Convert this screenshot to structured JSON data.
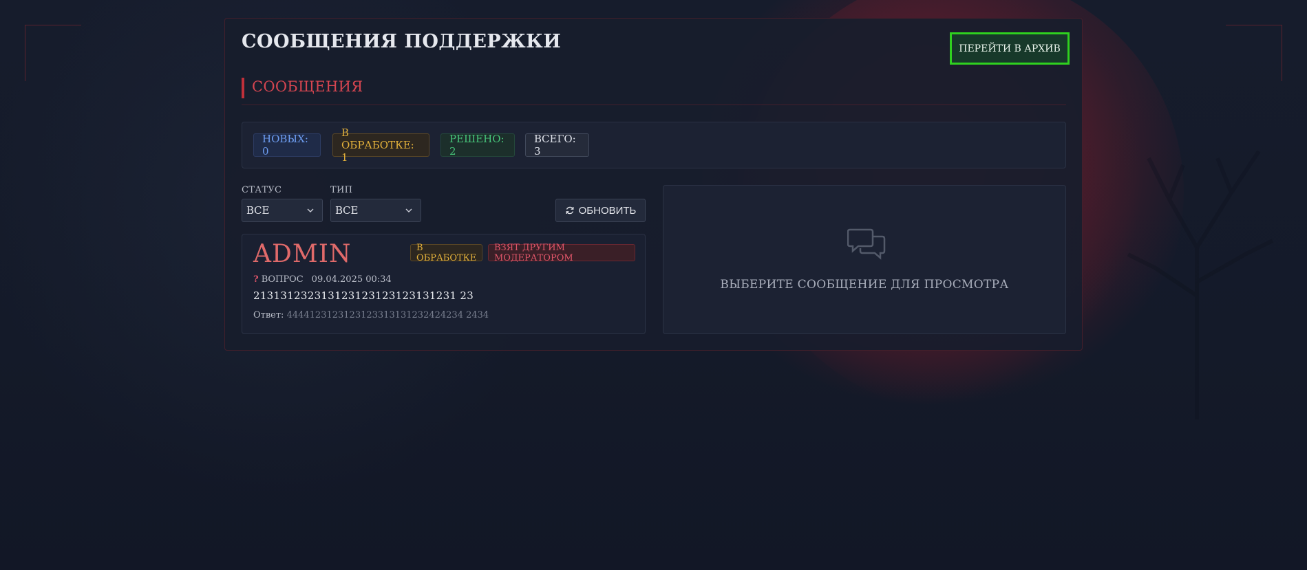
{
  "header": {
    "title": "СООБЩЕНИЯ ПОДДЕРЖКИ",
    "archive_button": "ПЕРЕЙТИ В АРХИВ"
  },
  "section": {
    "title": "СООБЩЕНИЯ"
  },
  "stats": {
    "new": "НОВЫХ: 0",
    "in_progress": "В ОБРАБОТКЕ: 1",
    "resolved": "РЕШЕНО: 2",
    "total": "ВСЕГО: 3"
  },
  "filters": {
    "status_label": "СТАТУС",
    "status_value": "ВСЕ",
    "type_label": "ТИП",
    "type_value": "ВСЕ",
    "refresh_button": "ОБНОВИТЬ"
  },
  "messages": [
    {
      "author": "ADMIN",
      "status_badge": "В ОБРАБОТКЕ",
      "assignee_badge": "ВЗЯТ ДРУГИМ МОДЕРАТОРОМ",
      "type": "ВОПРОС",
      "datetime": "09.04.2025 00:34",
      "text": "213131232313123123123123131231 23",
      "answer_label": "Ответ:",
      "answer_value": "4444123123123123313131232424234 2434"
    }
  ],
  "viewer": {
    "empty_text": "ВЫБЕРИТЕ СООБЩЕНИЕ ДЛЯ ПРОСМОТРА"
  },
  "colors": {
    "accent_red": "#c0303a",
    "archive_border": "#2fd11f",
    "new": "#6e9ef2",
    "in_progress": "#e3b13b",
    "resolved": "#47c47a"
  },
  "icons": {
    "refresh": "refresh-icon",
    "question": "question-icon",
    "chat": "chat-bubbles-icon",
    "chevron": "chevron-down-icon"
  }
}
